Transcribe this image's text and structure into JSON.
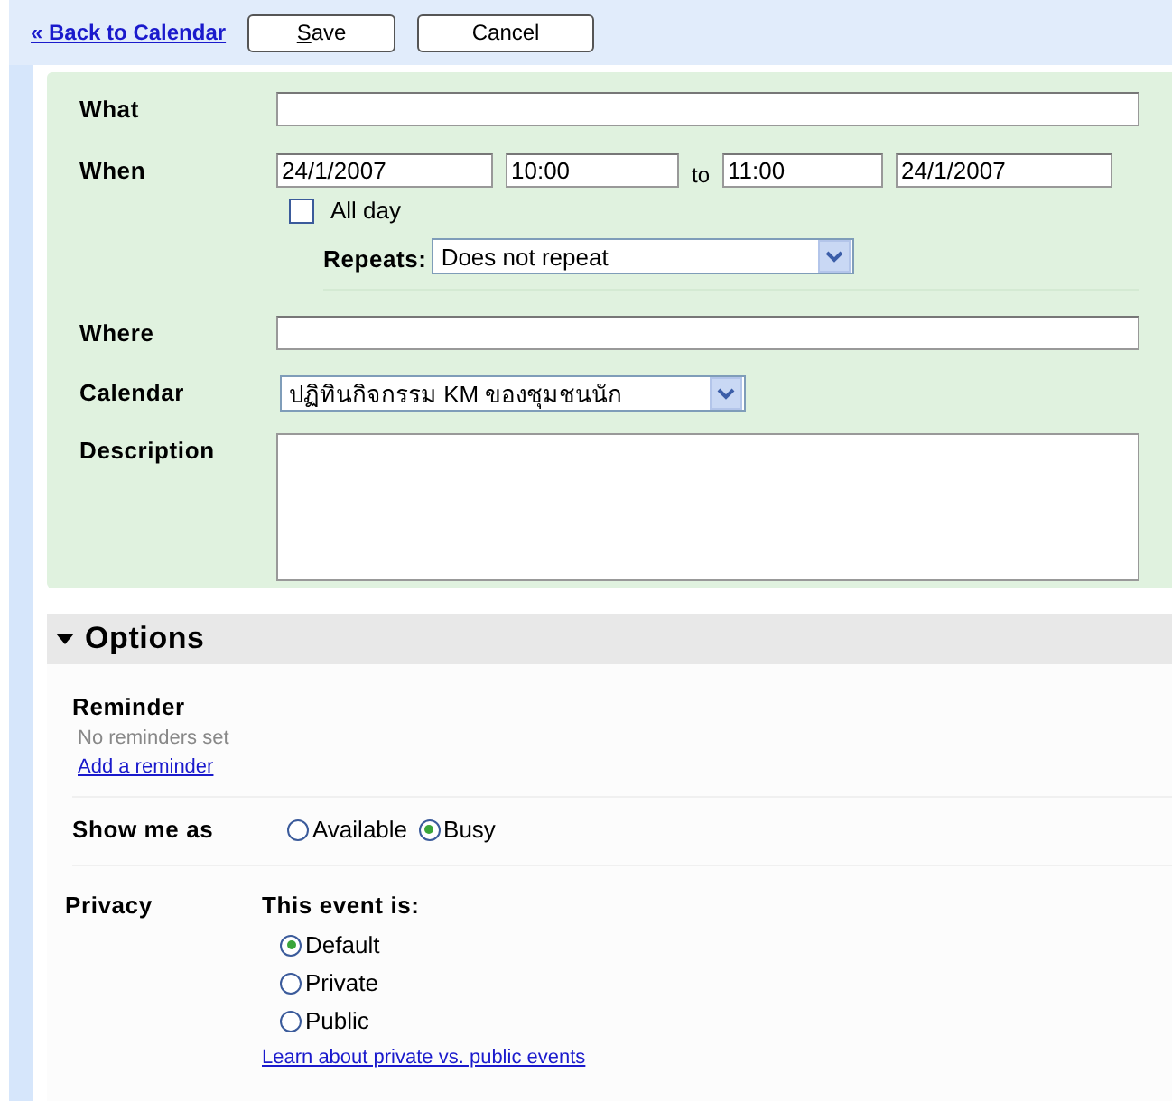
{
  "toolbar": {
    "back_link": "« Back to Calendar",
    "buttons": [
      "Save",
      "Cancel"
    ]
  },
  "event_form": {
    "what": {
      "label": "What"
    },
    "when": {
      "label": "When",
      "start_date": "24/1/2007",
      "start_time": "10:00",
      "separator": "to",
      "end_time": "11:00",
      "end_date": "24/1/2007",
      "all_day": {
        "label": "All day",
        "checked": false
      },
      "repeats": {
        "label": "Repeats:",
        "value": "Does not repeat"
      }
    },
    "where": {
      "label": "Where"
    },
    "calendar": {
      "label": "Calendar",
      "value": "ปฏิทินกิจกรรม KM ของชุมชนนัก"
    },
    "description": {
      "label": "Description"
    }
  },
  "options": {
    "title": "Options",
    "expanded": true,
    "reminder": {
      "label": "Reminder",
      "status": "No reminders set",
      "link": "Add a reminder"
    },
    "show_me_as": {
      "label": "Show me as",
      "choices": [
        {
          "label": "Available",
          "selected": false
        },
        {
          "label": "Busy",
          "selected": true
        }
      ]
    },
    "privacy": {
      "label": "Privacy",
      "heading": "This event is:",
      "choices": [
        {
          "label": "Default",
          "selected": true
        },
        {
          "label": "Private",
          "selected": false
        },
        {
          "label": "Public",
          "selected": false
        }
      ],
      "link": "Learn about private vs. public events"
    }
  }
}
